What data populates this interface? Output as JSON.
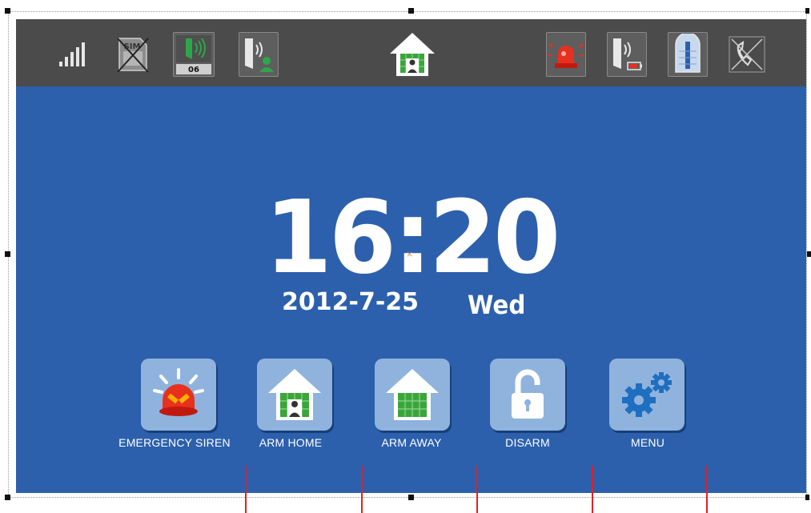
{
  "status_bar": {
    "signal_icon": "signal-strength-icon",
    "sim_icon": "no-sim-card-icon",
    "sim_label": "SIM",
    "zone_icon": "zone-sensor-icon",
    "zone_number": "06",
    "doorbell_user_icon": "door-sensor-user-icon",
    "mode_icon": "home-mode-icon",
    "siren_icon": "alarm-siren-icon",
    "battery_icon": "door-sensor-low-battery-icon",
    "door_icon": "door-status-icon",
    "phone_icon": "phone-disabled-icon"
  },
  "clock": {
    "time": "16:20",
    "date": "2012-7-25",
    "weekday": "Wed",
    "center_mark": "×"
  },
  "actions": [
    {
      "label": "EMERGENCY SIREN",
      "icon": "siren-icon"
    },
    {
      "label": "ARM HOME",
      "icon": "arm-home-icon"
    },
    {
      "label": "ARM AWAY",
      "icon": "arm-away-icon"
    },
    {
      "label": "DISARM",
      "icon": "unlock-icon"
    },
    {
      "label": "MENU",
      "icon": "gears-icon"
    }
  ],
  "colors": {
    "screen_bg": "#2c60ad",
    "status_bar_bg": "#4b4b4b",
    "button_bg": "#8fb3dd",
    "accent_green": "#3aa63a",
    "alarm_red": "#e8301e",
    "annotation_red": "#e41e26"
  }
}
